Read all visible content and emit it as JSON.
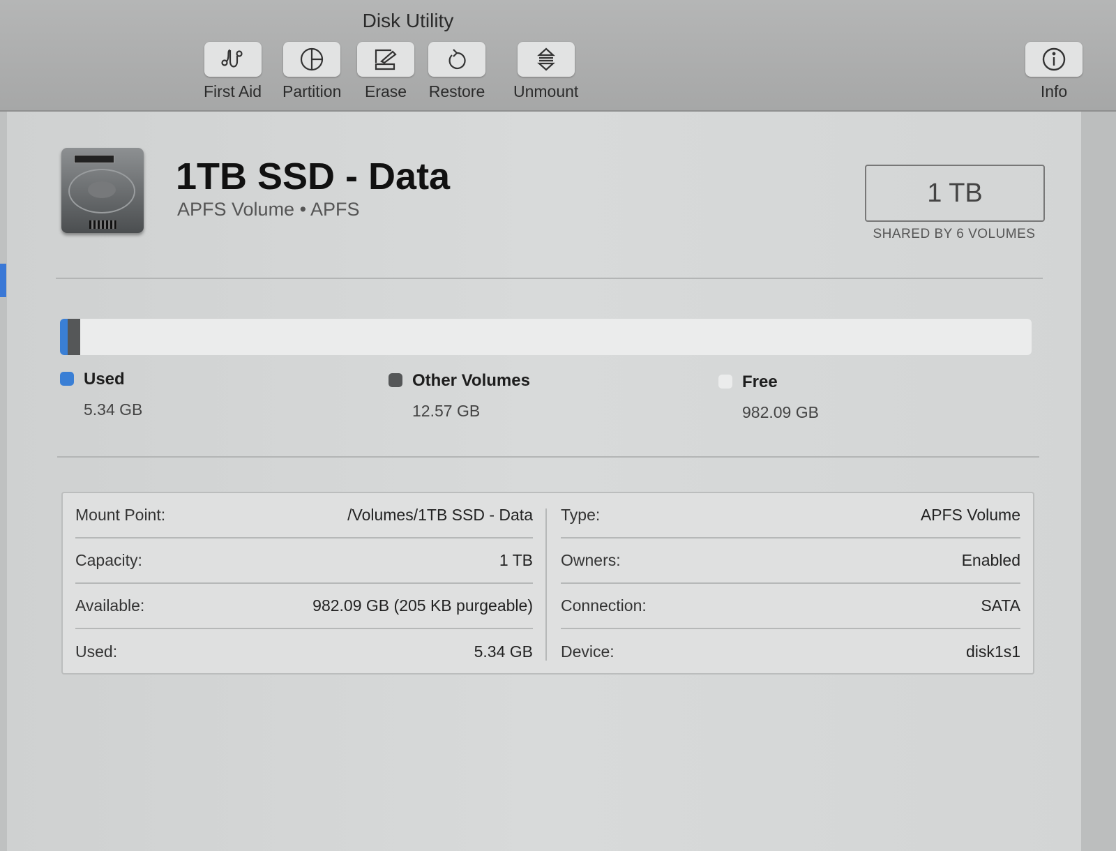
{
  "window": {
    "title": "Disk Utility"
  },
  "toolbar": {
    "buttons": [
      {
        "label": "First Aid",
        "icon": "stethoscope-icon"
      },
      {
        "label": "Partition",
        "icon": "pie-partition-icon"
      },
      {
        "label": "Erase",
        "icon": "erase-icon"
      },
      {
        "label": "Restore",
        "icon": "restore-icon"
      },
      {
        "label": "Unmount",
        "icon": "eject-icon"
      }
    ],
    "info": {
      "label": "Info",
      "icon": "info-icon"
    }
  },
  "volume": {
    "name": "1TB SSD - Data",
    "subtitle": "APFS Volume • APFS",
    "capacity": "1 TB",
    "shared": "SHARED BY 6 VOLUMES"
  },
  "usage": {
    "total_gb": 1000,
    "legend": [
      {
        "name": "Used",
        "value": "5.34 GB",
        "gb": 5.34,
        "color": "#3a7fd5"
      },
      {
        "name": "Other Volumes",
        "value": "12.57 GB",
        "gb": 12.57,
        "color": "#555758"
      },
      {
        "name": "Free",
        "value": "982.09 GB",
        "gb": 982.09,
        "color": "#ebecec"
      }
    ]
  },
  "info_table": {
    "left": [
      {
        "k": "Mount Point:",
        "v": "/Volumes/1TB SSD - Data"
      },
      {
        "k": "Capacity:",
        "v": "1 TB"
      },
      {
        "k": "Available:",
        "v": "982.09 GB (205 KB purgeable)"
      },
      {
        "k": "Used:",
        "v": "5.34 GB"
      }
    ],
    "right": [
      {
        "k": "Type:",
        "v": "APFS Volume"
      },
      {
        "k": "Owners:",
        "v": "Enabled"
      },
      {
        "k": "Connection:",
        "v": "SATA"
      },
      {
        "k": "Device:",
        "v": "disk1s1"
      }
    ]
  }
}
